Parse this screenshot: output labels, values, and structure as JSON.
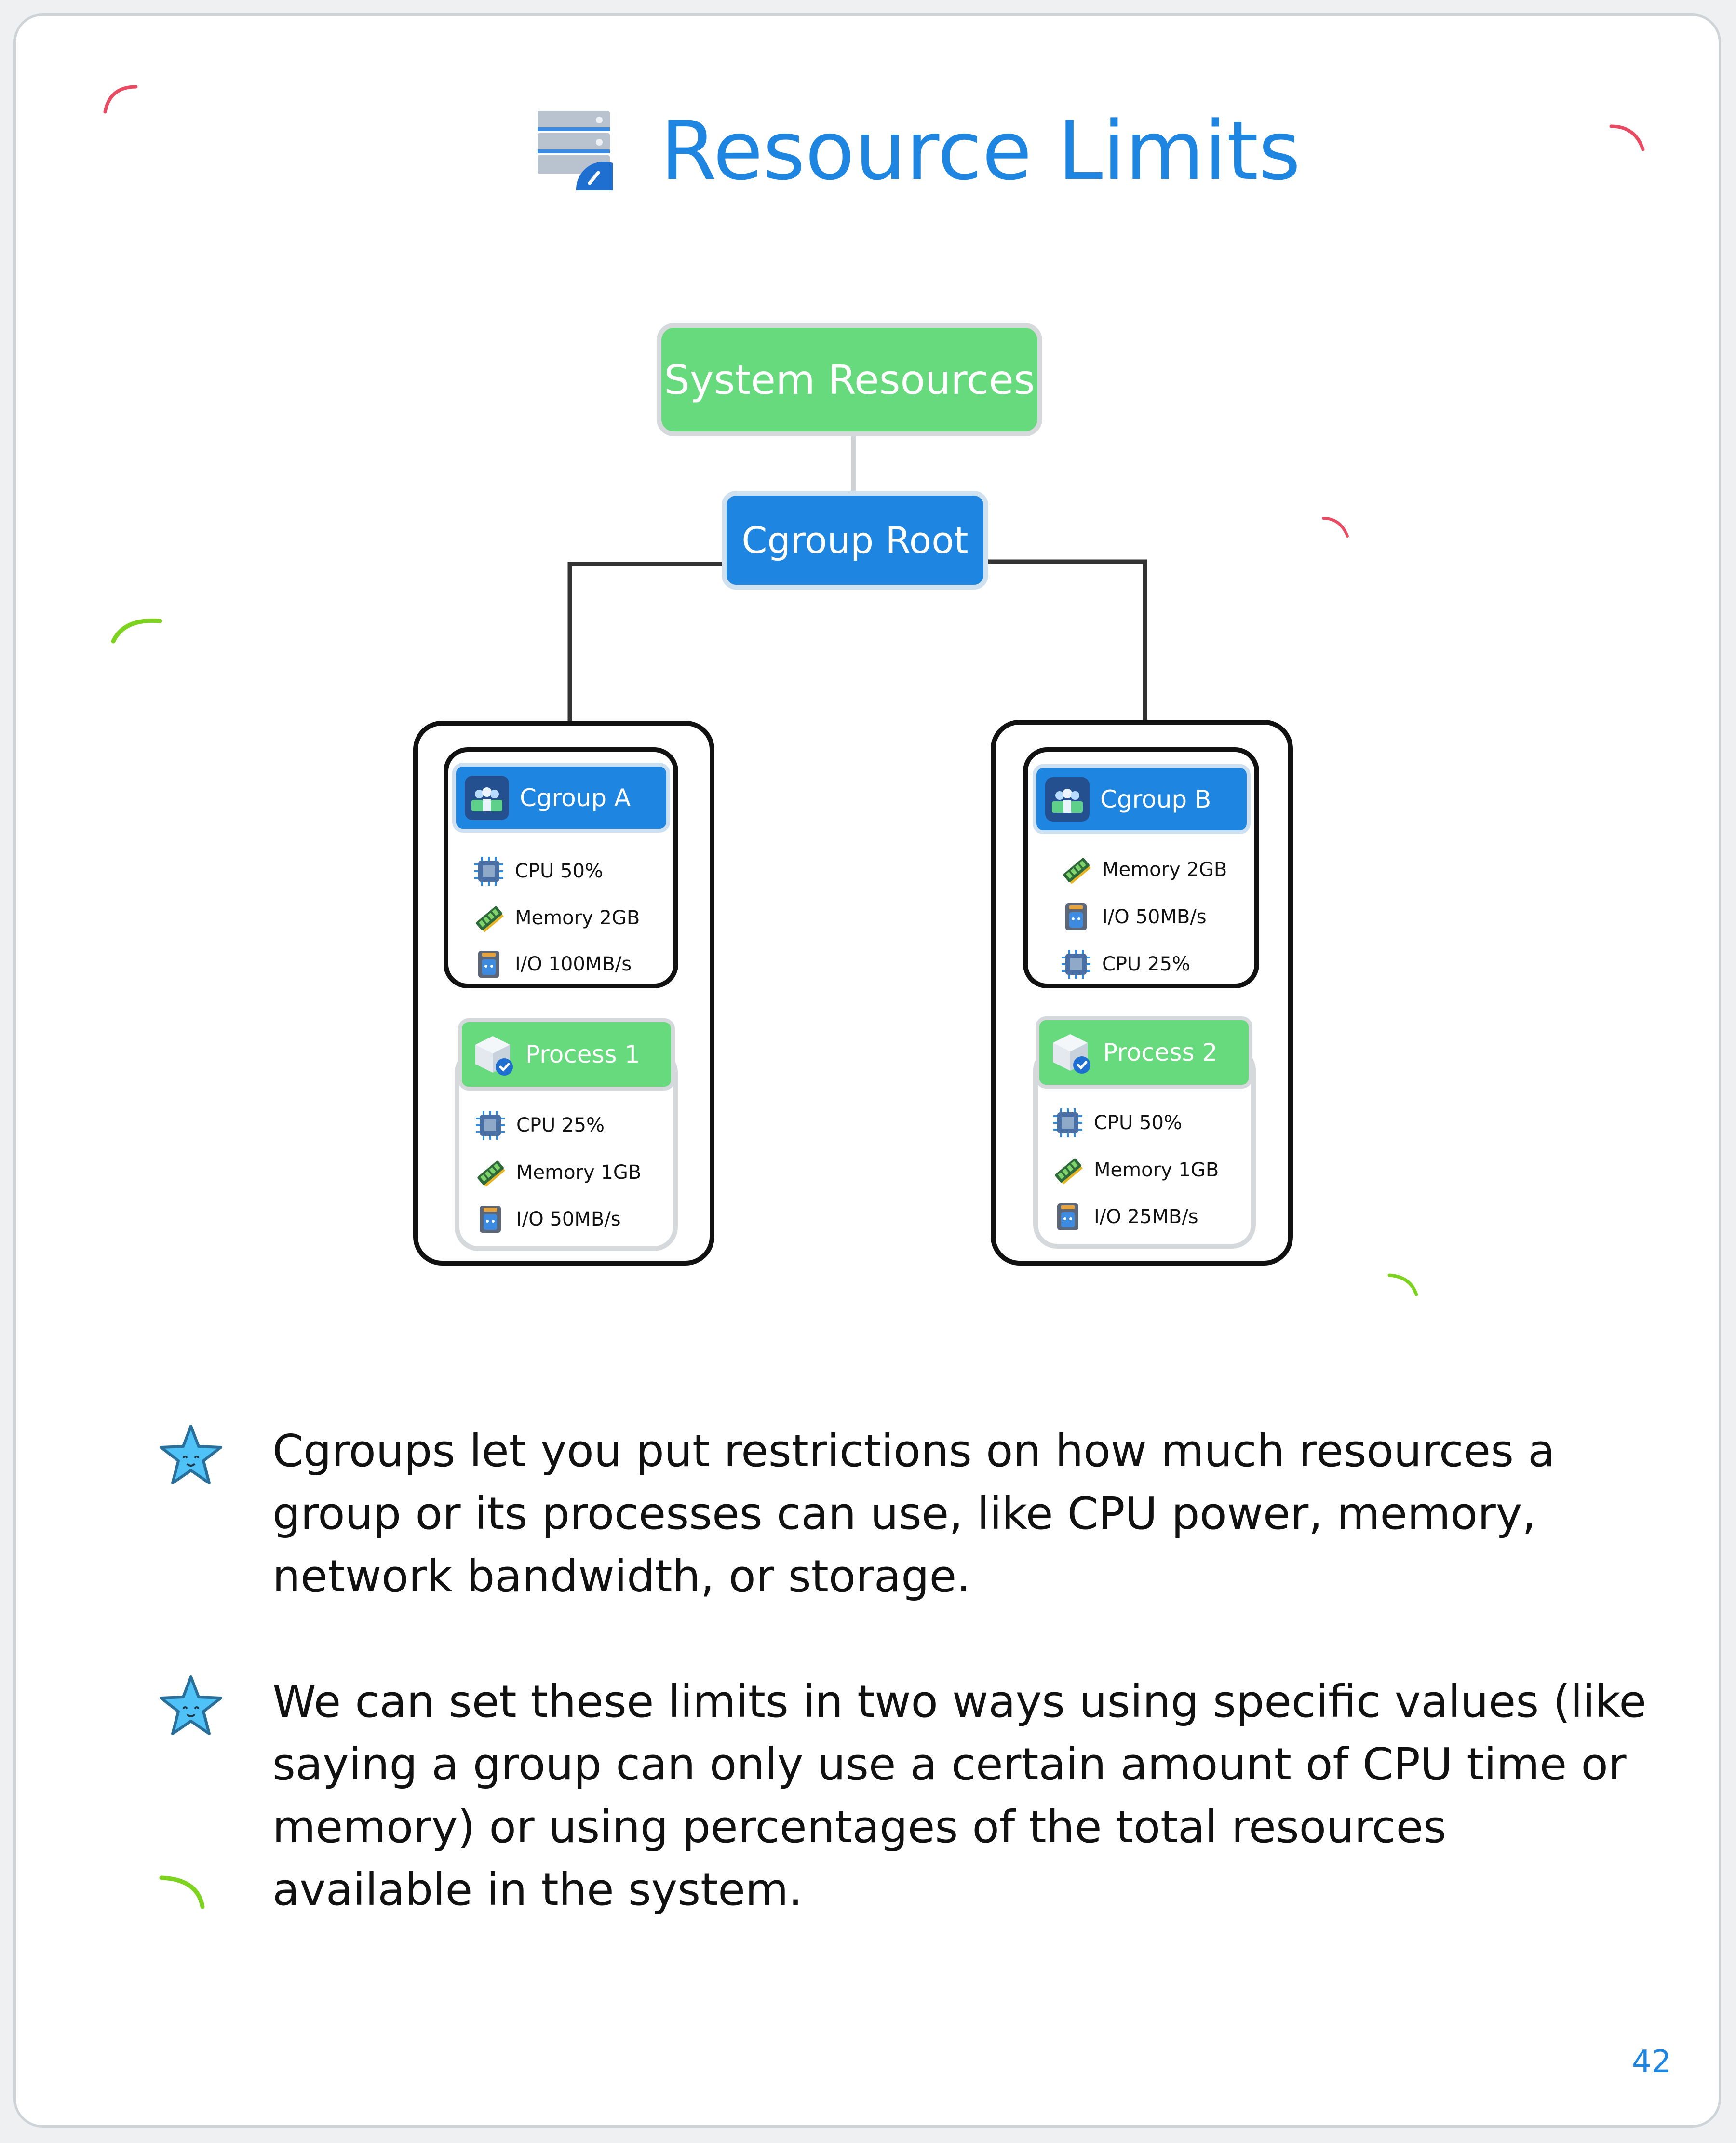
{
  "title": "Resource Limits",
  "diagram": {
    "root": "System Resources",
    "cgroup_root": "Cgroup Root",
    "groups": [
      {
        "name": "Cgroup A",
        "limits": [
          {
            "icon": "cpu-icon",
            "label": "CPU 50%"
          },
          {
            "icon": "memory-icon",
            "label": "Memory 2GB"
          },
          {
            "icon": "disk-icon",
            "label": "I/O 100MB/s"
          }
        ],
        "process": {
          "name": "Process 1",
          "limits": [
            {
              "icon": "cpu-icon",
              "label": "CPU 25%"
            },
            {
              "icon": "memory-icon",
              "label": "Memory 1GB"
            },
            {
              "icon": "disk-icon",
              "label": "I/O 50MB/s"
            }
          ]
        }
      },
      {
        "name": "Cgroup B",
        "limits": [
          {
            "icon": "memory-icon",
            "label": "Memory 2GB"
          },
          {
            "icon": "disk-icon",
            "label": "I/O 50MB/s"
          },
          {
            "icon": "cpu-icon",
            "label": "CPU 25%"
          }
        ],
        "process": {
          "name": "Process 2",
          "limits": [
            {
              "icon": "cpu-icon",
              "label": "CPU 50%"
            },
            {
              "icon": "memory-icon",
              "label": "Memory 1GB"
            },
            {
              "icon": "disk-icon",
              "label": "I/O 25MB/s"
            }
          ]
        }
      }
    ]
  },
  "bullets": [
    "Cgroups let you put restrictions on how much resources a group or its processes can use, like CPU power, memory, network bandwidth, or storage.",
    "We can set these limits in two ways using specific values (like saying a group can only use a certain amount of CPU time or memory) or using percentages of the total resources available in the system."
  ],
  "page_number": "42",
  "colors": {
    "accent_blue": "#1e85e0",
    "node_green": "#66da7c",
    "star_blue": "#4fc3f7"
  }
}
